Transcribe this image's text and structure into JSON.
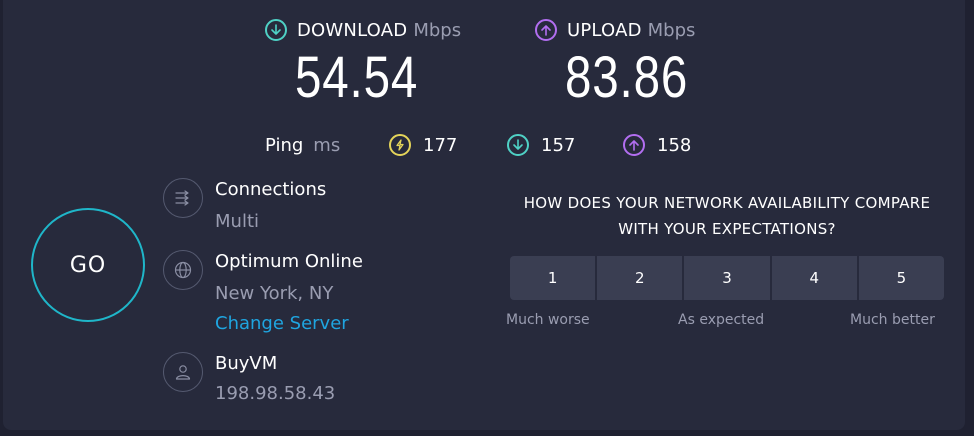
{
  "download": {
    "label": "DOWNLOAD",
    "unit": "Mbps",
    "value": "54.54",
    "color": "#4fd1c5"
  },
  "upload": {
    "label": "UPLOAD",
    "unit": "Mbps",
    "value": "83.86",
    "color": "#b26ef0"
  },
  "ping": {
    "label": "Ping",
    "unit": "ms",
    "idle": "177",
    "download": "157",
    "upload": "158",
    "idle_color": "#e4d45a"
  },
  "go_label": "GO",
  "connections": {
    "title": "Connections",
    "value": "Multi"
  },
  "provider": {
    "title": "Optimum Online",
    "location": "New York, NY",
    "change_link": "Change Server"
  },
  "host": {
    "title": "BuyVM",
    "ip": "198.98.58.43"
  },
  "survey": {
    "question": "HOW DOES YOUR NETWORK AVAILABILITY COMPARE WITH YOUR EXPECTATIONS?",
    "options": [
      "1",
      "2",
      "3",
      "4",
      "5"
    ],
    "low_label": "Much worse",
    "mid_label": "As expected",
    "high_label": "Much better"
  }
}
